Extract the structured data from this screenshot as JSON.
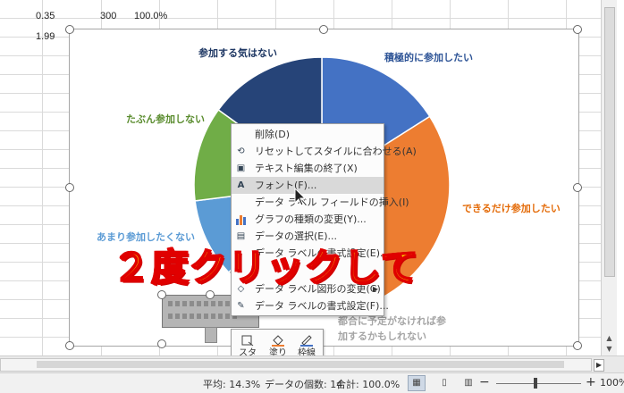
{
  "sheet": {
    "cells": {
      "a1": "0.35",
      "b1": "300",
      "c1": "100.0%",
      "a2": "1.99"
    }
  },
  "chart_data": {
    "type": "pie",
    "categories": [
      "積極的に参加したい",
      "できるだけ参加したい",
      "都合に予定がなければ参加するかもしれない",
      "あまり参加したくない",
      "たぶん参加しない",
      "参加する気はない"
    ],
    "values": [
      16,
      34,
      13,
      10,
      12,
      15
    ],
    "colors": [
      "#4472c4",
      "#ed7d31",
      "#a5a5a5",
      "#5b9bd5",
      "#70ad47",
      "#264478"
    ],
    "label_colors": [
      "#2f5597",
      "#e46c0a",
      "#a5a5a5",
      "#5b9bd5",
      "#5a8c2e",
      "#1f3864"
    ],
    "labels": {
      "active": "積極的に参加したい",
      "maybe": "できるだけ参加したい",
      "busy_line1": "都合に予定がなければ参",
      "busy_line2": "加するかもしれない",
      "reluctant": "あまり参加したくない",
      "probably_not": "たぶん参加しない",
      "not_interested": "参加する気はない"
    }
  },
  "context_menu": {
    "items": [
      {
        "label": "削除(D)",
        "icon": "delete-icon"
      },
      {
        "label": "リセットしてスタイルに合わせる(A)",
        "icon": "reset-style-icon"
      },
      {
        "label": "テキスト編集の終了(X)",
        "icon": "exit-text-edit-icon"
      },
      {
        "label": "フォント(F)...",
        "icon": "font-icon"
      },
      {
        "label": "データ ラベル フィールドの挿入(I)",
        "icon": ""
      },
      {
        "label": "グラフの種類の変更(Y)...",
        "icon": "chart-type-icon"
      },
      {
        "label": "データの選択(E)...",
        "icon": "select-data-icon"
      },
      {
        "label": "データ ラベルの書式設定(E)...",
        "icon": "label-format-icon"
      },
      {
        "label": "データ ラベル図形の変更(C)",
        "icon": "label-shape-icon"
      },
      {
        "label": "データ ラベルの書式設定(F)...",
        "icon": "format-label-icon"
      }
    ],
    "highlighted_index": 3
  },
  "overlay": {
    "instruction": "２度クリックして"
  },
  "mini_toolbar": {
    "style": "スタイル",
    "fill": "塗りつぶし",
    "outline": "枠線"
  },
  "status_bar": {
    "average": "平均: 14.3%",
    "count": "データの個数: 14",
    "sum": "合計: 100.0%",
    "zoom": "100%"
  }
}
